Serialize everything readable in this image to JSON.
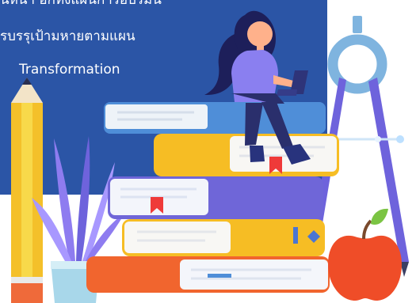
{
  "banner": {
    "lines": [
      "นหน้า อีกทั้งแผนการอบรมน",
      "รบรรุเป้ามหายตามแผน",
      "Transformation"
    ]
  },
  "colors": {
    "panel": "#2b55a6",
    "book_blue": "#4f8ed8",
    "book_yellow": "#f6bd24",
    "book_purple": "#6f66d8",
    "book_orange": "#f1652e",
    "apple": "#ef4d28",
    "pencil": "#f4c02a"
  }
}
